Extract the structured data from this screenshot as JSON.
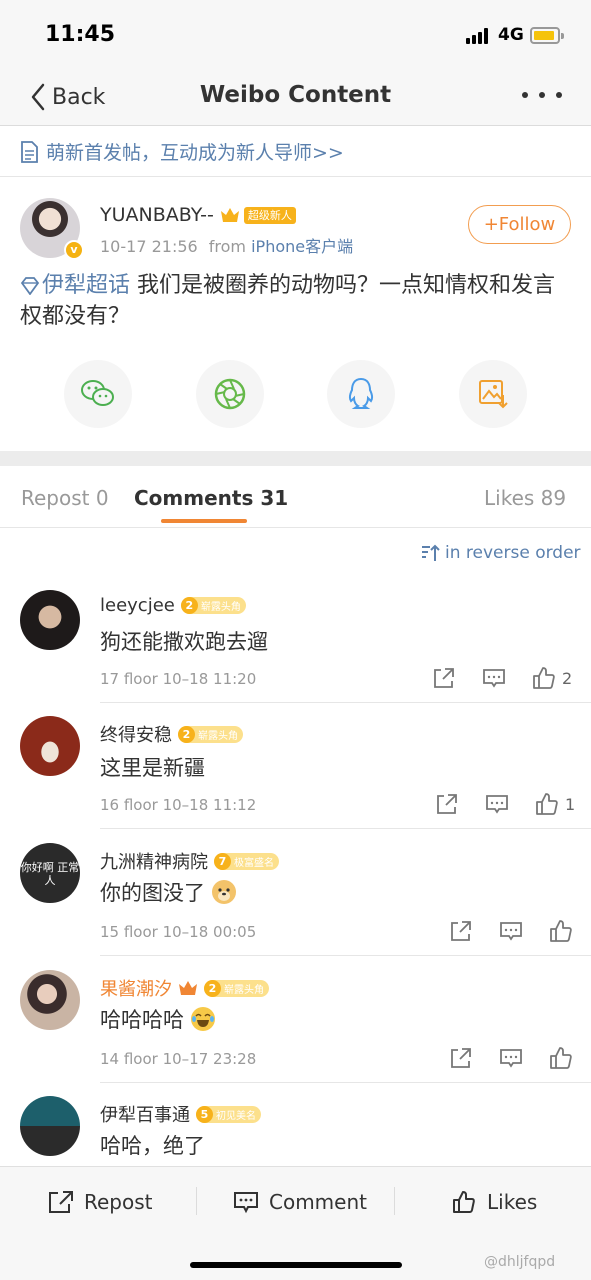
{
  "status_bar": {
    "time": "11:45",
    "network": "4G"
  },
  "nav": {
    "back_label": "Back",
    "title": "Weibo Content"
  },
  "banner": {
    "text": "萌新首发帖，互动成为新人导师>>"
  },
  "post": {
    "author": "YUANBABY--",
    "author_tag": "超级新人",
    "date": "10-17 21:56",
    "from_label": "from",
    "source": "iPhone客户端",
    "follow_label": "+Follow",
    "topic": "伊犁超话",
    "text": " 我们是被圈养的动物吗？一点知情权和发言权都没有？"
  },
  "share_icons": [
    "wechat-icon",
    "moments-icon",
    "qq-icon",
    "save-image-icon"
  ],
  "tabs": [
    {
      "label": "Repost",
      "count": "0"
    },
    {
      "label": "Comments",
      "count": "31"
    },
    {
      "label": "Likes",
      "count": "89"
    }
  ],
  "sort": {
    "label": "in reverse order"
  },
  "comments": [
    {
      "name": "leeycjee",
      "level": "2",
      "badge": "崭露头角",
      "text": "狗还能撒欢跑去遛",
      "meta": "17 floor 10–18 11:20",
      "likes": "2"
    },
    {
      "name": "终得安稳",
      "level": "2",
      "badge": "崭露头角",
      "text": "这里是新疆",
      "meta": "16 floor 10–18 11:12",
      "likes": "1"
    },
    {
      "name": "九洲精神病院",
      "level": "7",
      "badge": "极富盛名",
      "text": "你的图没了",
      "meta": "15 floor 10–18 00:05",
      "likes": "",
      "avatar_text": "你好啊 正常人"
    },
    {
      "name": "果酱潮汐",
      "level": "2",
      "badge": "崭露头角",
      "text": "哈哈哈哈",
      "meta": "14 floor 10–17 23:28",
      "likes": ""
    },
    {
      "name": "伊犁百事通",
      "level": "5",
      "badge": "初见美名",
      "text": "哈哈，绝了"
    }
  ],
  "bottom_bar": {
    "repost": "Repost",
    "comment": "Comment",
    "likes": "Likes"
  },
  "watermark": "@dhljfqpd",
  "colors": {
    "link_blue": "#5b80ad",
    "accent_orange": "#f08634",
    "badge_gold": "#f7b21b"
  }
}
